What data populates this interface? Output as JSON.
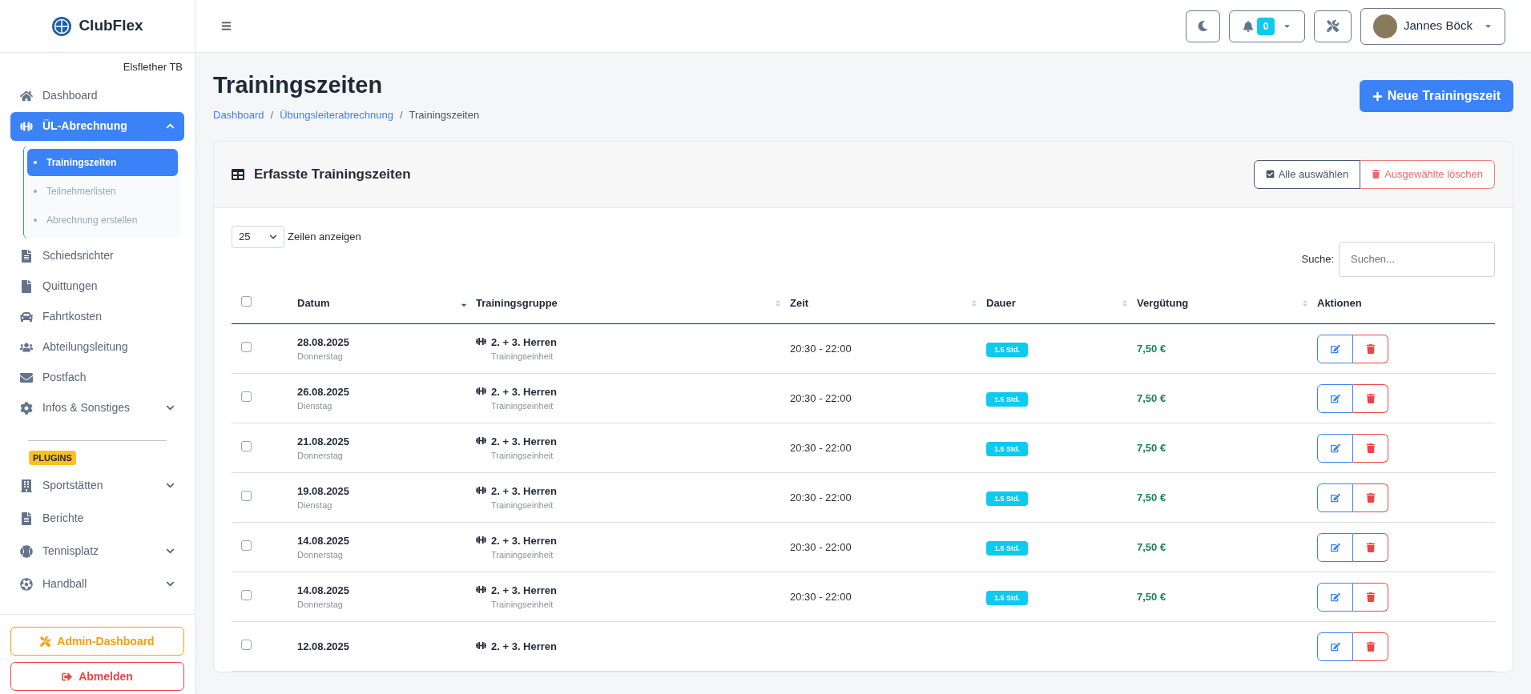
{
  "brand": {
    "name": "ClubFlex"
  },
  "sidebar": {
    "club": "Elsflether TB",
    "items": [
      {
        "label": "Dashboard",
        "selected": false
      },
      {
        "label": "ÜL-Abrechnung",
        "selected": true,
        "expanded": true,
        "children": [
          {
            "label": "Trainingszeiten",
            "selected": true
          },
          {
            "label": "Teilnehmerlisten",
            "selected": false
          },
          {
            "label": "Abrechnung erstellen",
            "selected": false
          }
        ]
      },
      {
        "label": "Schiedsrichter",
        "selected": false
      },
      {
        "label": "Quittungen",
        "selected": false
      },
      {
        "label": "Fahrtkosten",
        "selected": false
      },
      {
        "label": "Abteilungsleitung",
        "selected": false
      },
      {
        "label": "Postfach",
        "selected": false
      },
      {
        "label": "Infos & Sonstiges",
        "selected": false,
        "expanded": false
      }
    ],
    "section_badge": "PLUGINS",
    "plugin_items": [
      {
        "label": "Sportstätten",
        "selected": false,
        "expanded": false
      },
      {
        "label": "Berichte",
        "selected": false
      },
      {
        "label": "Tennisplatz",
        "selected": false,
        "expanded": false
      },
      {
        "label": "Handball",
        "selected": false,
        "expanded": false
      }
    ],
    "buttons": [
      {
        "label": "Admin-Dashboard",
        "kind": "admin"
      },
      {
        "label": "Abmelden",
        "kind": "logout"
      }
    ]
  },
  "topbar": {
    "notifications": "0",
    "user": "Jannes Böck"
  },
  "page": {
    "title": "Trainingszeiten",
    "breadcrumb_separator": "/",
    "breadcrumbs": [
      {
        "label": "Dashboard",
        "link": true
      },
      {
        "label": "Übungsleiterabrechnung",
        "link": true
      },
      {
        "label": "Trainingszeiten",
        "link": false
      }
    ],
    "primary_button": "Neue Trainingszeit"
  },
  "card": {
    "title": "Erfasste Trainingszeiten",
    "select_all": "Alle auswählen",
    "delete_selected": "Ausgewählte löschen",
    "page_size": "25",
    "page_size_label": "Zeilen anzeigen",
    "search_label": "Suche:",
    "search_placeholder": "Suchen...",
    "header_checked": false,
    "columns": [
      {
        "label": "Datum",
        "sorted": true
      },
      {
        "label": "Trainingsgruppe",
        "sorted": false
      },
      {
        "label": "Zeit",
        "sorted": false
      },
      {
        "label": "Dauer",
        "sorted": false
      },
      {
        "label": "Vergütung",
        "sorted": false
      },
      {
        "label": "Aktionen"
      }
    ],
    "rows": [
      {
        "checked": false,
        "date": "28.08.2025",
        "weekday": "Donnerstag",
        "group": "2. + 3. Herren",
        "type": "Trainingseinheit",
        "time": "20:30 - 22:00",
        "duration": "1.5 Std.",
        "pay": "7,50 €"
      },
      {
        "checked": false,
        "date": "26.08.2025",
        "weekday": "Dienstag",
        "group": "2. + 3. Herren",
        "type": "Trainingseinheit",
        "time": "20:30 - 22:00",
        "duration": "1.5 Std.",
        "pay": "7,50 €"
      },
      {
        "checked": false,
        "date": "21.08.2025",
        "weekday": "Donnerstag",
        "group": "2. + 3. Herren",
        "type": "Trainingseinheit",
        "time": "20:30 - 22:00",
        "duration": "1.5 Std.",
        "pay": "7,50 €"
      },
      {
        "checked": false,
        "date": "19.08.2025",
        "weekday": "Dienstag",
        "group": "2. + 3. Herren",
        "type": "Trainingseinheit",
        "time": "20:30 - 22:00",
        "duration": "1.5 Std.",
        "pay": "7,50 €"
      },
      {
        "checked": false,
        "date": "14.08.2025",
        "weekday": "Donnerstag",
        "group": "2. + 3. Herren",
        "type": "Trainingseinheit",
        "time": "20:30 - 22:00",
        "duration": "1.5 Std.",
        "pay": "7,50 €"
      },
      {
        "checked": false,
        "date": "14.08.2025",
        "weekday": "Donnerstag",
        "group": "2. + 3. Herren",
        "type": "Trainingseinheit",
        "time": "20:30 - 22:00",
        "duration": "1.5 Std.",
        "pay": "7,50 €"
      },
      {
        "checked": false,
        "date": "12.08.2025",
        "group": "2. + 3. Herren"
      }
    ]
  }
}
